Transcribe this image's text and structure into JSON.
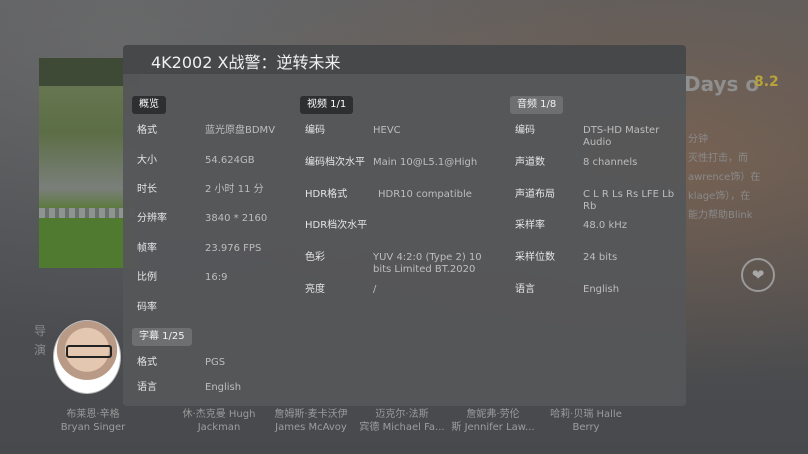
{
  "background": {
    "movie_title": "Days o",
    "rating": "8.2",
    "description_lines": [
      "分钟",
      "灭性打击，而",
      "awrence饰）在",
      "klage饰），在",
      "能力帮助Blink"
    ],
    "left_label": "导演",
    "cast": [
      {
        "cn": "布莱恩·辛格",
        "en": "Bryan Singer"
      },
      {
        "cn": "休·杰克曼 Hugh",
        "en": "Jackman"
      },
      {
        "cn": "詹姆斯·麦卡沃伊",
        "en": "James McAvoy"
      },
      {
        "cn": "迈克尔·法斯",
        "en": "宾德 Michael Fa..."
      },
      {
        "cn": "詹妮弗·劳伦",
        "en": "斯 Jennifer Law..."
      },
      {
        "cn": "哈莉·贝瑞 Halle",
        "en": "Berry"
      }
    ],
    "heart_icon": "heart-icon"
  },
  "dialog": {
    "title": "4K2002 X战警：逆转未来",
    "general": {
      "tab": "概览",
      "rows": [
        {
          "label": "格式",
          "value": "蓝光原盘BDMV"
        },
        {
          "label": "大小",
          "value": "54.624GB"
        },
        {
          "label": "时长",
          "value": "2 小时 11 分"
        },
        {
          "label": "分辨率",
          "value": "3840 * 2160"
        },
        {
          "label": "帧率",
          "value": "23.976 FPS"
        },
        {
          "label": "比例",
          "value": "16:9"
        },
        {
          "label": "码率",
          "value": ""
        }
      ]
    },
    "video": {
      "tab": "视频 1/1",
      "rows": [
        {
          "label": "编码",
          "value": "HEVC"
        },
        {
          "label": "编码档次水平",
          "value": "Main 10@L5.1@High"
        },
        {
          "label": "HDR格式",
          "value": "HDR10 compatible"
        },
        {
          "label": "HDR档次水平",
          "value": ""
        },
        {
          "label": "色彩",
          "value": "YUV 4:2:0 (Type 2) 10 bits Limited BT.2020"
        },
        {
          "label": "亮度",
          "value": "/"
        }
      ]
    },
    "audio": {
      "tab": "音频 1/8",
      "rows": [
        {
          "label": "编码",
          "value": "DTS-HD Master Audio"
        },
        {
          "label": "声道数",
          "value": "8 channels"
        },
        {
          "label": "声道布局",
          "value": "C L R Ls Rs LFE Lb Rb"
        },
        {
          "label": "采样率",
          "value": "48.0 kHz"
        },
        {
          "label": "采样位数",
          "value": "24 bits"
        },
        {
          "label": "语言",
          "value": "English"
        }
      ]
    },
    "subtitle": {
      "tab": "字幕 1/25",
      "rows": [
        {
          "label": "格式",
          "value": "PGS"
        },
        {
          "label": "语言",
          "value": "English"
        }
      ]
    }
  }
}
